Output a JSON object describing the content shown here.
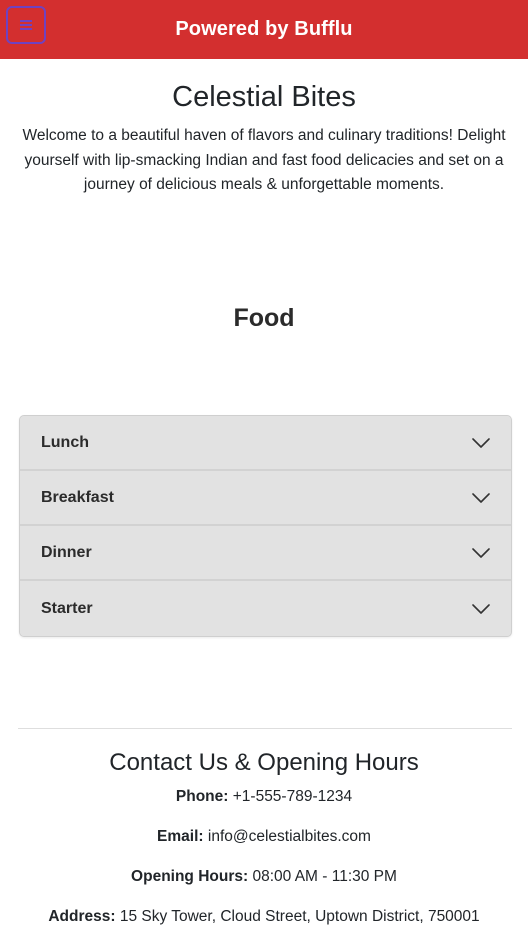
{
  "header": {
    "title": "Powered by Bufflu",
    "menu_icon": "hamburger-menu-icon",
    "background_color": "#d32f2f",
    "menu_border_color": "#6f42c1"
  },
  "brand": {
    "name": "Celestial Bites",
    "welcome": "Welcome to a beautiful haven of flavors and culinary traditions! Delight yourself with lip-smacking Indian and fast food delicacies and set on a journey of delicious meals & unforgettable moments."
  },
  "menu_section": {
    "title": "Food",
    "categories": [
      {
        "label": "Lunch",
        "icon": "chevron-down-icon"
      },
      {
        "label": "Breakfast",
        "icon": "chevron-down-icon"
      },
      {
        "label": "Dinner",
        "icon": "chevron-down-icon"
      },
      {
        "label": "Starter",
        "icon": "chevron-down-icon"
      }
    ]
  },
  "contact": {
    "title": "Contact Us & Opening Hours",
    "phone_label": "Phone:",
    "phone": "+1-555-789-1234",
    "email_label": "Email:",
    "email": "info@celestialbites.com",
    "hours_label": "Opening Hours:",
    "hours": "08:00 AM - 11:30 PM",
    "address_label": "Address:",
    "address": "15 Sky Tower, Cloud Street, Uptown District, 750001"
  }
}
